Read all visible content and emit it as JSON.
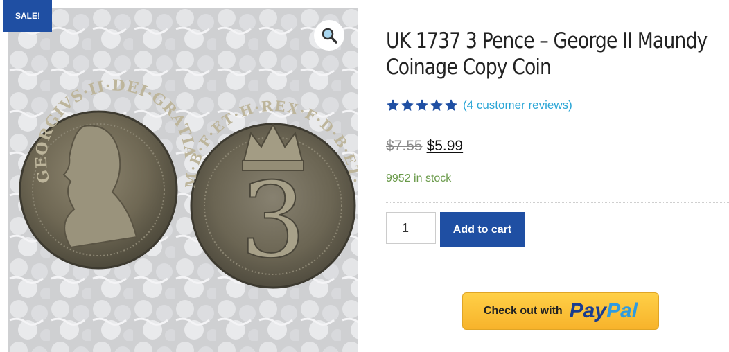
{
  "badge": {
    "sale": "SALE!"
  },
  "gallery": {
    "zoom_icon": "magnifier-icon",
    "left_coin_legend": "GEORGIVS·II·DEI·GRATIA",
    "right_coin_legend": "M·B·F·ET·H·REX·F·D·B·ET·L·D·S·R·I·A·T·ET·E",
    "right_coin_numeral": "3"
  },
  "product": {
    "title": "UK 1737 3 Pence – George II Maundy Coinage Copy Coin",
    "rating": 5,
    "reviews_link": "(4 customer reviews)",
    "price_old": "$7.55",
    "price_new": "$5.99",
    "stock": "9952 in stock"
  },
  "cart": {
    "quantity": "1",
    "add_to_cart": "Add to cart"
  },
  "paypal": {
    "label": "Check out with",
    "brand_a": "Pay",
    "brand_b": "Pal"
  },
  "colors": {
    "accent": "#1f4fa3",
    "link": "#2ba6d6",
    "stock": "#6a9a4a",
    "paypal_yellow": "#ffc439"
  }
}
